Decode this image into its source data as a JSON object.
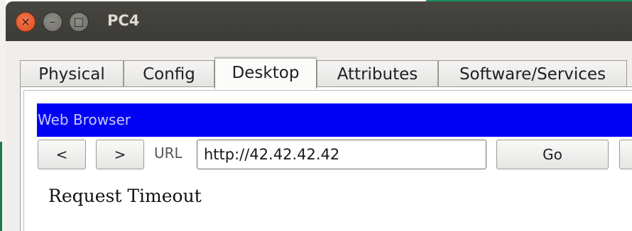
{
  "window": {
    "title": "PC4",
    "close_glyph": "×",
    "minimize_glyph": "–",
    "maximize_glyph": "□"
  },
  "tabs": [
    {
      "label": "Physical",
      "active": false
    },
    {
      "label": "Config",
      "active": false
    },
    {
      "label": "Desktop",
      "active": true
    },
    {
      "label": "Attributes",
      "active": false
    },
    {
      "label": "Software/Services",
      "active": false
    }
  ],
  "browser": {
    "header": "Web Browser",
    "back_label": "<",
    "forward_label": ">",
    "url_label": "URL",
    "url_value": "http://42.42.42.42",
    "go_label": "Go",
    "content_text": "Request Timeout"
  },
  "colors": {
    "header_bg": "#0000f5",
    "close_button": "#df4a1c",
    "titlebar_bg": "#3c3b37"
  }
}
